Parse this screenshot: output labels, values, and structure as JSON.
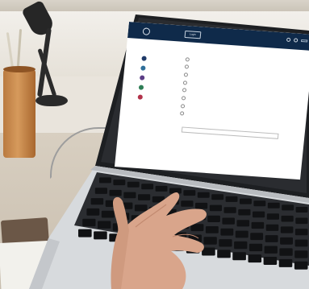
{
  "app": {
    "org_name": "",
    "header_button": "Login",
    "title": "",
    "top_right_button": "",
    "note": "",
    "input_placeholder": "",
    "steps": [
      {
        "label": "",
        "color": "#1f3a68"
      },
      {
        "label": "",
        "color": "#2f6f9a"
      },
      {
        "label": "",
        "color": "#5c3e86"
      },
      {
        "label": "",
        "color": "#2e7d56"
      },
      {
        "label": "",
        "color": "#b2324a"
      }
    ],
    "questions": [
      "",
      "",
      "",
      "",
      "",
      "",
      "",
      ""
    ],
    "bottom_links": [
      "",
      ""
    ]
  },
  "colors": {
    "header": "#0f2a4a",
    "accent_green": "#2f7a58",
    "laptop_body": "#d7dadd",
    "laptop_bezel": "#1d1f22",
    "skin": "#d9a58b"
  },
  "icons": [
    "crest-icon",
    "user-icon",
    "search-icon"
  ]
}
